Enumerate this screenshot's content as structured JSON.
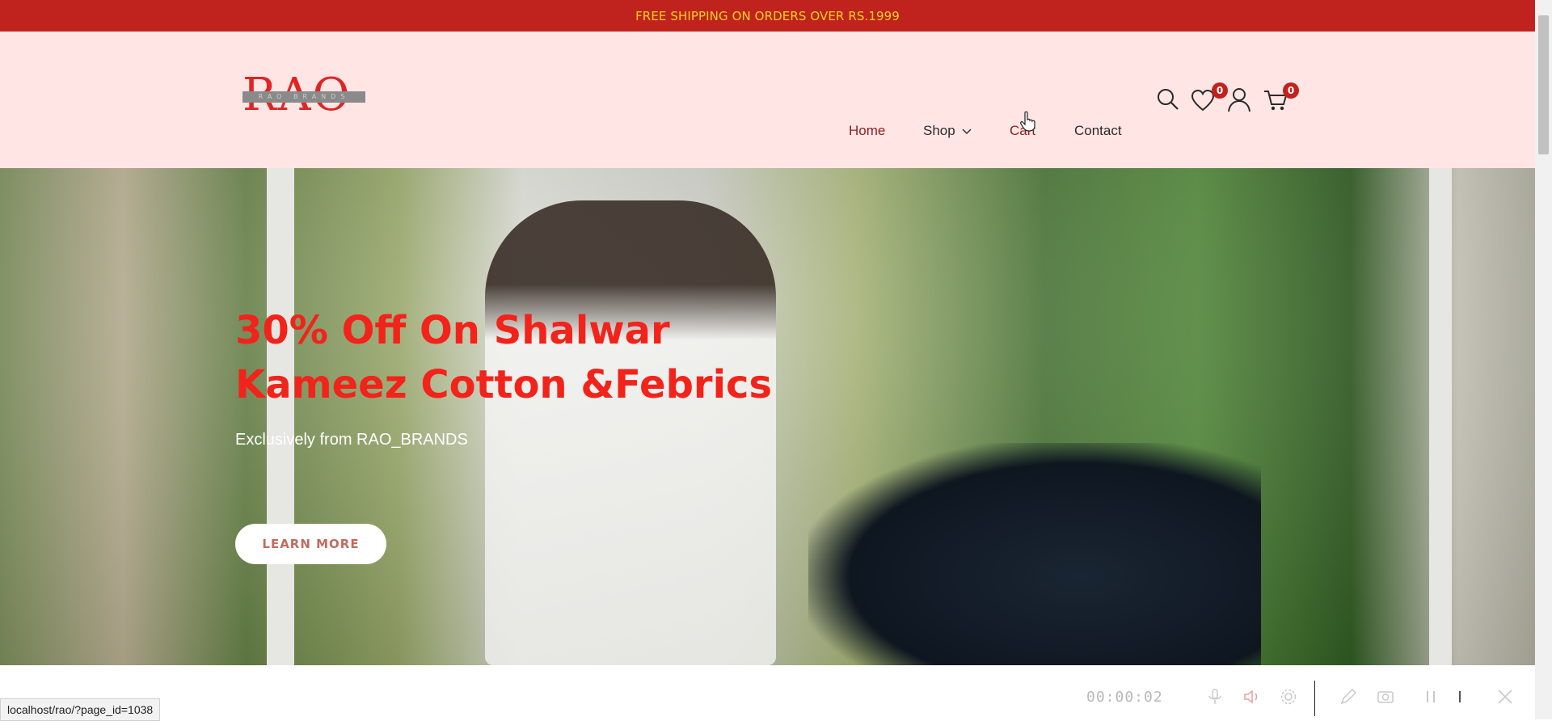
{
  "promo": {
    "text": "FREE SHIPPING ON ORDERS OVER RS.1999"
  },
  "brand": {
    "name": "RAO",
    "tagline": "RAO BRANDS"
  },
  "nav": {
    "home": "Home",
    "shop": "Shop",
    "cart": "Cart",
    "contact": "Contact"
  },
  "icons": {
    "wishlist_count": "0",
    "cart_count": "0"
  },
  "hero": {
    "headline": "30% Off On Shalwar Kameez Cotton &Febrics",
    "subtitle": "Exclusively from RAO_BRANDS",
    "button": "LEARN MORE"
  },
  "status": {
    "url": "localhost/rao/?page_id=1038"
  },
  "recorder": {
    "timer": "00:00:02"
  },
  "colors": {
    "accent_red": "#c0221e",
    "promo_yellow": "#f5d21f",
    "header_bg": "#ffe6e4",
    "headline_red": "#f2231a"
  }
}
